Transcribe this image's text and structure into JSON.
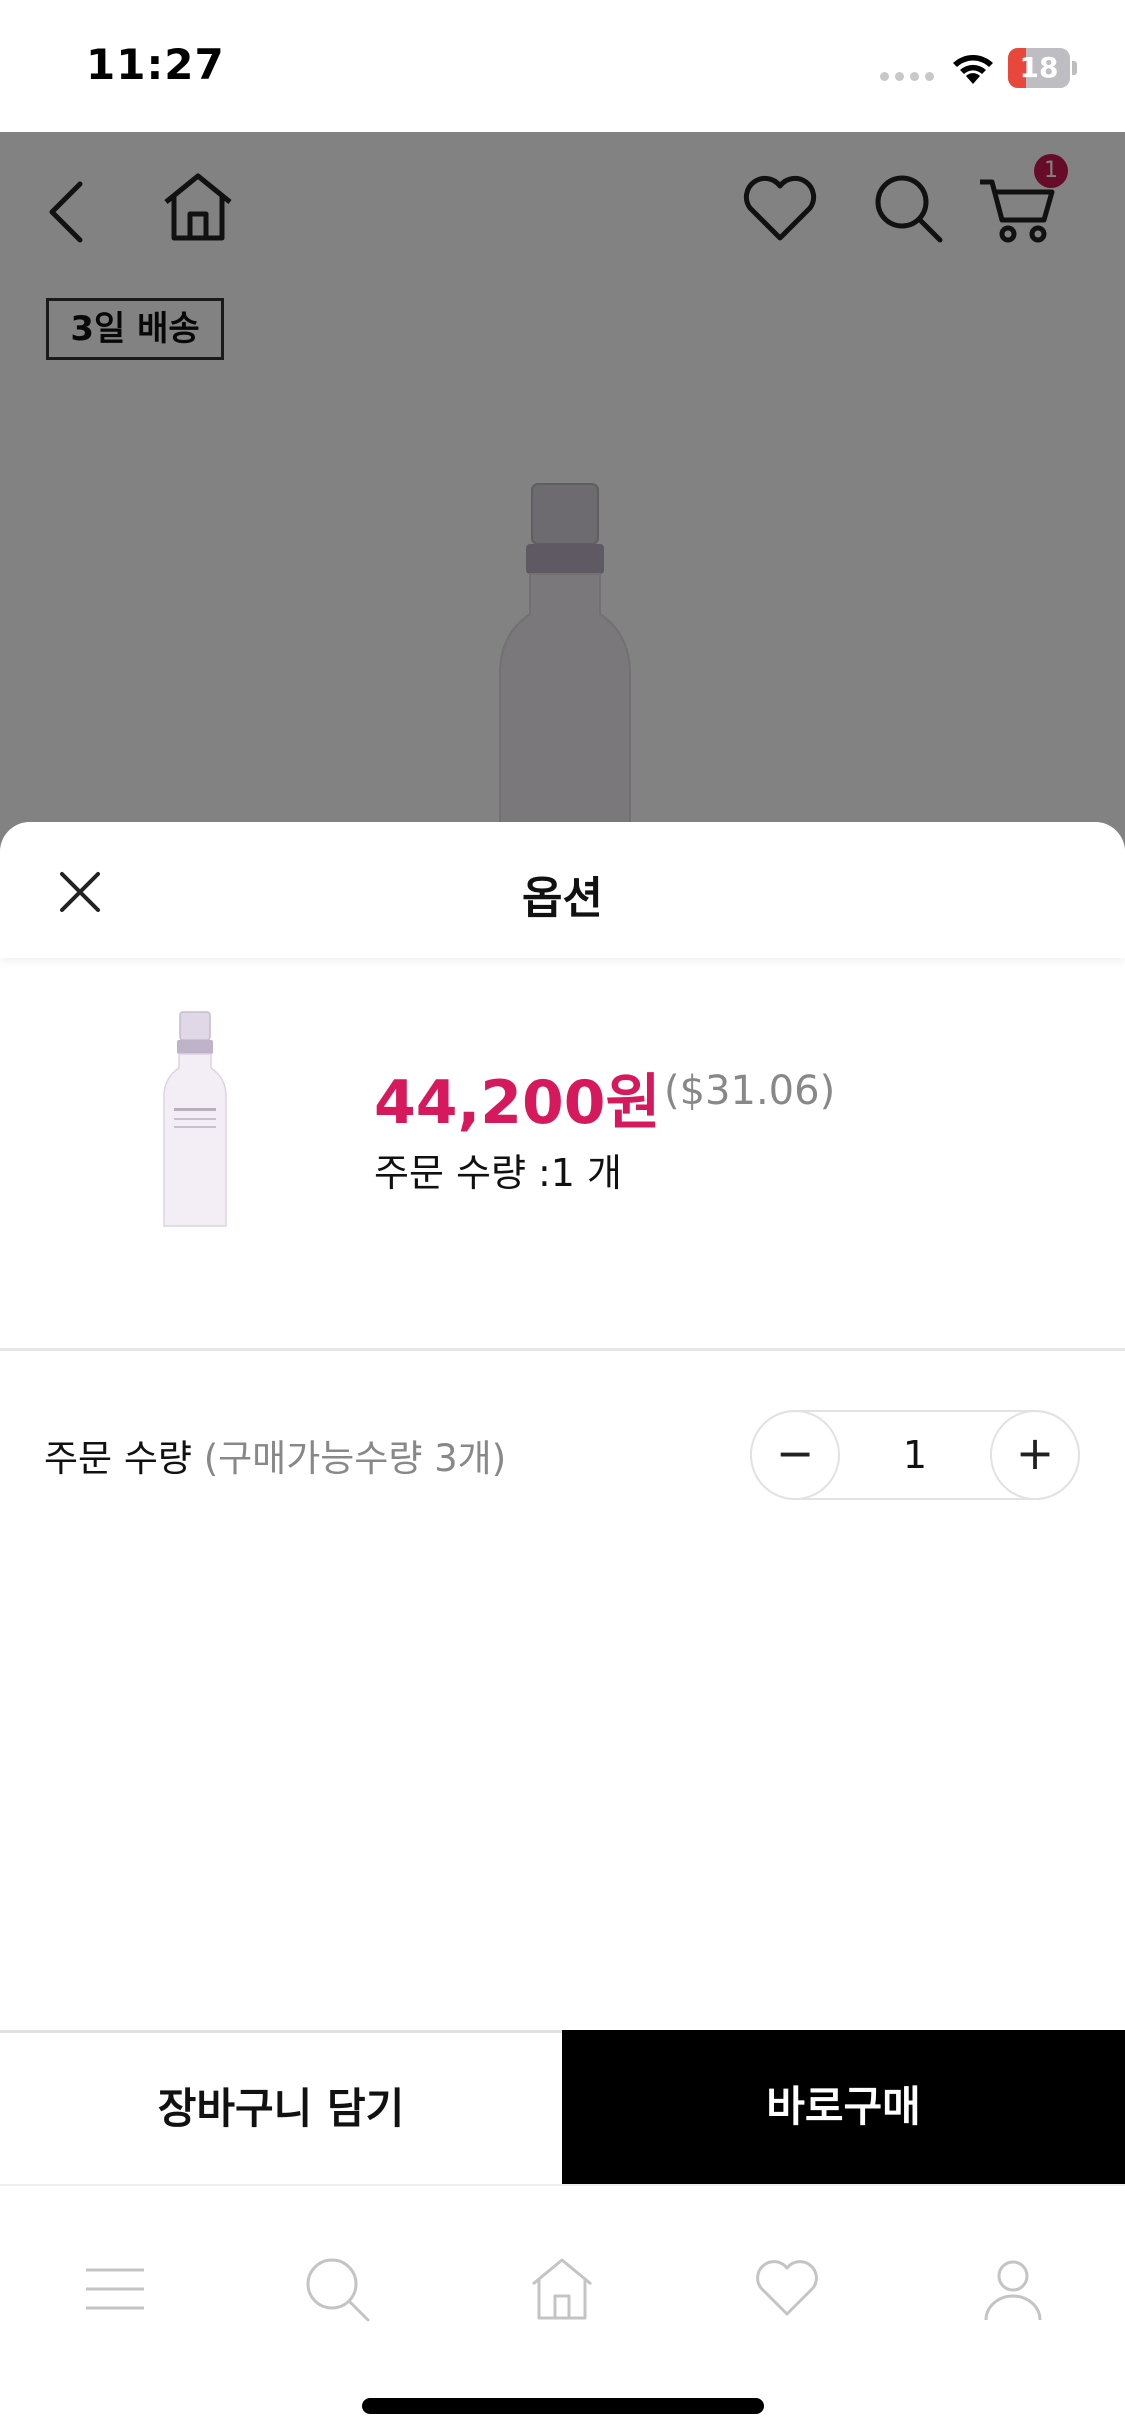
{
  "status_bar": {
    "time": "11:27",
    "battery_level": "18"
  },
  "product_page": {
    "cart_count": "1",
    "delivery_badge": "3일 배송"
  },
  "sheet": {
    "title": "옵션",
    "price": "44,200원",
    "usd_price": "($31.06)",
    "order_quantity_summary": "주문 수량 :1 개",
    "quantity_label": "주문 수량",
    "quantity_hint": "(구매가능수량 3개)",
    "quantity_value": "1",
    "minus_symbol": "−",
    "plus_symbol": "+",
    "add_to_cart_label": "장바구니 담기",
    "buy_now_label": "바로구매"
  },
  "tab_bar": {
    "items": [
      {
        "icon": "menu-icon"
      },
      {
        "icon": "search-icon"
      },
      {
        "icon": "home-icon"
      },
      {
        "icon": "heart-icon"
      },
      {
        "icon": "profile-icon"
      }
    ]
  },
  "colors": {
    "price": "#d6195c",
    "badge": "#c8174f",
    "buy_button": "#000000",
    "overlay": "rgba(0,0,0,0.49)"
  }
}
